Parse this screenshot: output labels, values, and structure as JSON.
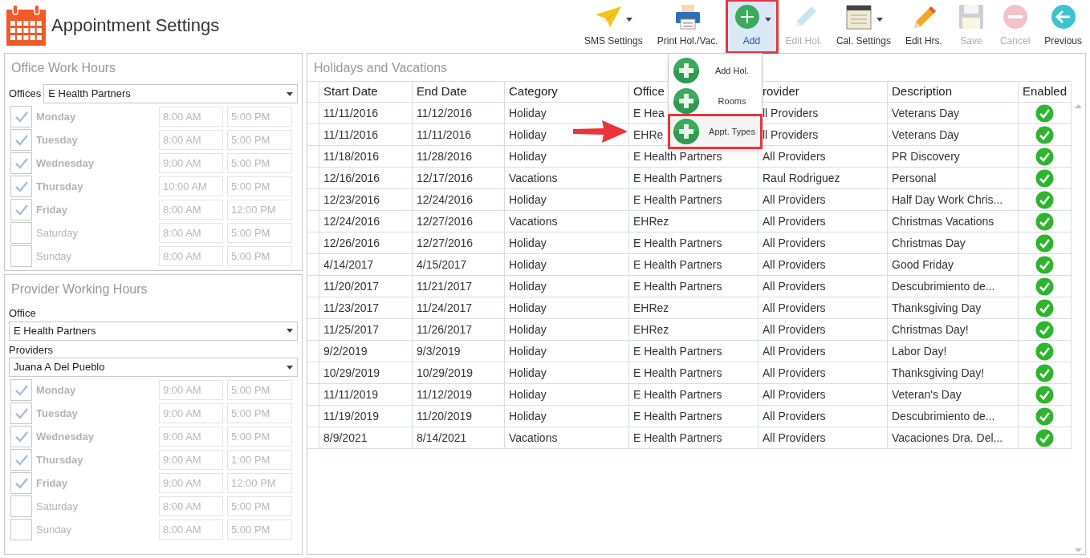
{
  "title": "Appointment Settings",
  "toolbar": [
    {
      "label": "SMS Settings",
      "kind": "send",
      "disabled": false,
      "has_menu": true,
      "selected": false,
      "highlighted": false
    },
    {
      "label": "Print Hol./Vac.",
      "kind": "print",
      "disabled": false,
      "has_menu": false,
      "selected": false,
      "highlighted": false
    },
    {
      "label": "Add",
      "kind": "add",
      "disabled": false,
      "has_menu": true,
      "selected": true,
      "highlighted": true
    },
    {
      "label": "Edit Hol.",
      "kind": "edit",
      "disabled": true,
      "has_menu": false,
      "selected": false,
      "highlighted": false
    },
    {
      "label": "Cal. Settings",
      "kind": "calendar",
      "disabled": false,
      "has_menu": true,
      "selected": false,
      "highlighted": false
    },
    {
      "label": "Edit Hrs.",
      "kind": "pencil",
      "disabled": false,
      "has_menu": false,
      "selected": false,
      "highlighted": false
    },
    {
      "label": "Save",
      "kind": "save",
      "disabled": true,
      "has_menu": false,
      "selected": false,
      "highlighted": false
    },
    {
      "label": "Cancel",
      "kind": "cancel",
      "disabled": true,
      "has_menu": false,
      "selected": false,
      "highlighted": false
    },
    {
      "label": "Previous",
      "kind": "back",
      "disabled": false,
      "has_menu": false,
      "selected": false,
      "highlighted": false
    }
  ],
  "add_menu": [
    {
      "label": "Add Hol.",
      "highlighted": false
    },
    {
      "label": "Rooms",
      "highlighted": false
    },
    {
      "label": "Appt. Types",
      "highlighted": true
    }
  ],
  "office_hours": {
    "title": "Office Work Hours",
    "offices_label": "Offices",
    "office": "E Health Partners",
    "disabled": true,
    "days": [
      {
        "day": "Monday",
        "checked": true,
        "start": "8:00 AM",
        "end": "5:00 PM"
      },
      {
        "day": "Tuesday",
        "checked": true,
        "start": "8:00 AM",
        "end": "5:00 PM"
      },
      {
        "day": "Wednesday",
        "checked": true,
        "start": "9:00 AM",
        "end": "5:00 PM"
      },
      {
        "day": "Thursday",
        "checked": true,
        "start": "10:00 AM",
        "end": "5:00 PM"
      },
      {
        "day": "Friday",
        "checked": true,
        "start": "8:00 AM",
        "end": "12:00 PM"
      },
      {
        "day": "Saturday",
        "checked": false,
        "start": "8:00 AM",
        "end": "5:00 PM"
      },
      {
        "day": "Sunday",
        "checked": false,
        "start": "8:00 AM",
        "end": "5:00 PM"
      }
    ]
  },
  "provider_hours": {
    "title": "Provider Working Hours",
    "office_label": "Office",
    "office": "E Health Partners",
    "providers_label": "Providers",
    "provider": "Juana A Del Pueblo",
    "disabled": true,
    "days": [
      {
        "day": "Monday",
        "checked": true,
        "start": "9:00 AM",
        "end": "5:00 PM"
      },
      {
        "day": "Tuesday",
        "checked": true,
        "start": "9:00 AM",
        "end": "5:00 PM"
      },
      {
        "day": "Wednesday",
        "checked": true,
        "start": "9:00 AM",
        "end": "5:00 PM"
      },
      {
        "day": "Thursday",
        "checked": true,
        "start": "9:00 AM",
        "end": "1:00 PM"
      },
      {
        "day": "Friday",
        "checked": true,
        "start": "9:00 AM",
        "end": "12:00 PM"
      },
      {
        "day": "Saturday",
        "checked": false,
        "start": "8:00 AM",
        "end": "5:00 PM"
      },
      {
        "day": "Sunday",
        "checked": false,
        "start": "8:00 AM",
        "end": "5:00 PM"
      }
    ]
  },
  "holidays": {
    "title": "Holidays and Vacations",
    "columns": [
      "Start Date",
      "End Date",
      "Category",
      "Office",
      "rovider",
      "Description",
      "Enabled"
    ],
    "rows": [
      {
        "cells": [
          "11/11/2016",
          "11/12/2016",
          "Holiday",
          "E Hea",
          "ll Providers",
          "Veterans Day"
        ],
        "enabled": true
      },
      {
        "cells": [
          "11/11/2016",
          "11/11/2016",
          "Holiday",
          "EHRe",
          "ll Providers",
          "Veterans Day"
        ],
        "enabled": true
      },
      {
        "cells": [
          "11/18/2016",
          "11/28/2016",
          "Holiday",
          "E Health Partners",
          "All Providers",
          "PR Discovery"
        ],
        "enabled": true
      },
      {
        "cells": [
          "12/16/2016",
          "12/17/2016",
          "Vacations",
          "E Health Partners",
          "Raul Rodriguez",
          "Personal"
        ],
        "enabled": true
      },
      {
        "cells": [
          "12/23/2016",
          "12/24/2016",
          "Holiday",
          "E Health Partners",
          "All Providers",
          "Half Day Work Chris..."
        ],
        "enabled": true
      },
      {
        "cells": [
          "12/24/2016",
          "12/27/2016",
          "Vacations",
          "EHRez",
          "All Providers",
          "Christmas Vacations"
        ],
        "enabled": true
      },
      {
        "cells": [
          "12/26/2016",
          "12/27/2016",
          "Holiday",
          "E Health Partners",
          "All Providers",
          "Christmas Day"
        ],
        "enabled": true
      },
      {
        "cells": [
          "4/14/2017",
          "4/15/2017",
          "Holiday",
          "E Health Partners",
          "All Providers",
          "Good Friday"
        ],
        "enabled": true
      },
      {
        "cells": [
          "11/20/2017",
          "11/21/2017",
          "Holiday",
          "E Health Partners",
          "All Providers",
          "Descubrimiento de..."
        ],
        "enabled": true
      },
      {
        "cells": [
          "11/23/2017",
          "11/24/2017",
          "Holiday",
          "EHRez",
          "All Providers",
          "Thanksgiving Day"
        ],
        "enabled": true
      },
      {
        "cells": [
          "11/25/2017",
          "11/26/2017",
          "Holiday",
          "EHRez",
          "All Providers",
          "Christmas Day!"
        ],
        "enabled": true
      },
      {
        "cells": [
          "9/2/2019",
          "9/3/2019",
          "Holiday",
          "E Health Partners",
          "All Providers",
          "Labor Day!"
        ],
        "enabled": true
      },
      {
        "cells": [
          "10/29/2019",
          "10/29/2019",
          "Holiday",
          "E Health Partners",
          "All Providers",
          "Thanksgiving Day!"
        ],
        "enabled": true
      },
      {
        "cells": [
          "11/11/2019",
          "11/12/2019",
          "Holiday",
          "E Health Partners",
          "All Providers",
          "Veteran's Day"
        ],
        "enabled": true
      },
      {
        "cells": [
          "11/19/2019",
          "11/20/2019",
          "Holiday",
          "E Health Partners",
          "All Providers",
          "Descubrimiento de..."
        ],
        "enabled": true
      },
      {
        "cells": [
          "8/9/2021",
          "8/14/2021",
          "Vacations",
          "E Health Partners",
          "All Providers",
          "Vacaciones Dra. Del..."
        ],
        "enabled": true
      }
    ]
  }
}
